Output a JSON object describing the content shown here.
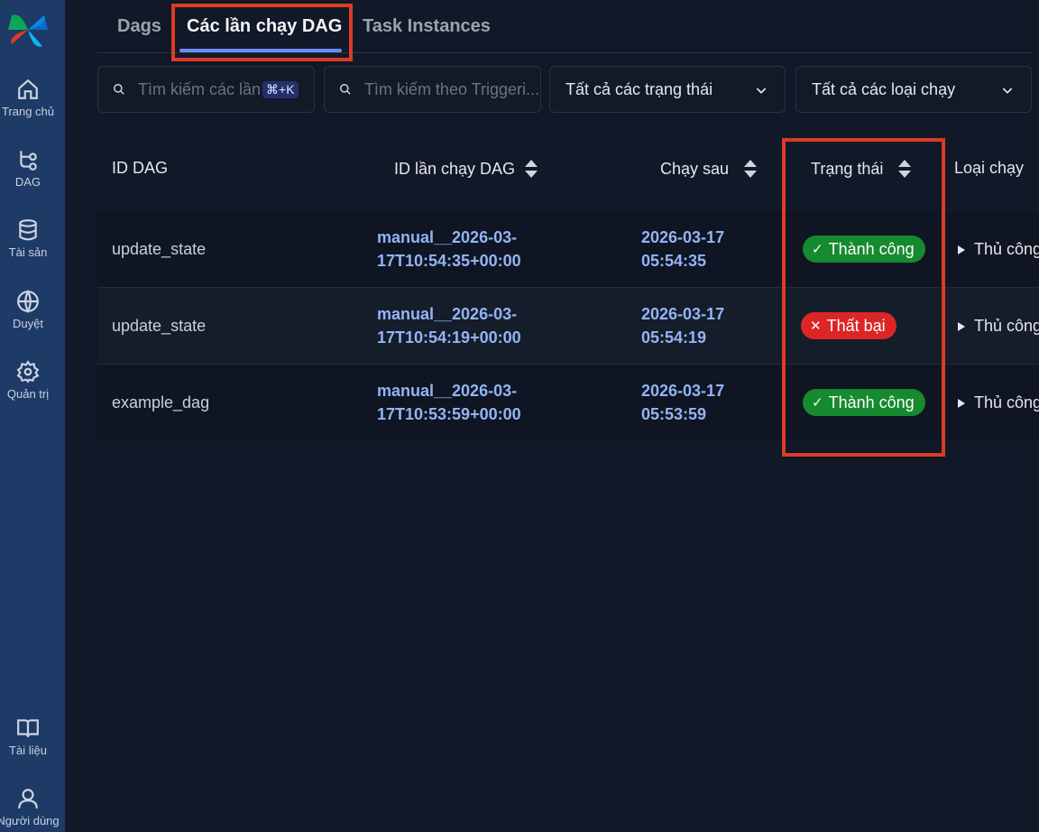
{
  "sidebar": {
    "items": [
      {
        "label": "Trang chủ",
        "icon": "home-icon"
      },
      {
        "label": "DAG",
        "icon": "dag-icon"
      },
      {
        "label": "Tài sản",
        "icon": "database-icon"
      },
      {
        "label": "Duyệt",
        "icon": "globe-icon"
      },
      {
        "label": "Quản trị",
        "icon": "gear-icon"
      }
    ],
    "bottom_items": [
      {
        "label": "Tài liệu",
        "icon": "book-icon"
      },
      {
        "label": "Người dùng",
        "icon": "user-icon"
      }
    ]
  },
  "tabs": [
    {
      "label": "Dags"
    },
    {
      "label": "Các lần chạy DAG"
    },
    {
      "label": "Task Instances"
    }
  ],
  "filters": {
    "search_runs_placeholder": "Tìm kiếm các lần",
    "search_runs_shortcut": "⌘+K",
    "search_trigger_placeholder": "Tìm kiếm theo Triggeri...",
    "state_select": "Tất cả các trạng thái",
    "run_type_select": "Tất cả các loại chạy"
  },
  "table": {
    "columns": [
      "ID DAG",
      "ID lần chạy DAG",
      "Chạy sau",
      "Trạng thái",
      "Loại chạy"
    ],
    "rows": [
      {
        "dag_id": "update_state",
        "run_id_1": "manual__2026-03-",
        "run_id_2": "17T10:54:35+00:00",
        "after_1": "2026-03-17",
        "after_2": "05:54:35",
        "state": "Thành công",
        "run_type": "Thủ công"
      },
      {
        "dag_id": "update_state",
        "run_id_1": "manual__2026-03-",
        "run_id_2": "17T10:54:19+00:00",
        "after_1": "2026-03-17",
        "after_2": "05:54:19",
        "state": "Thất bại",
        "run_type": "Thủ công"
      },
      {
        "dag_id": "example_dag",
        "run_id_1": "manual__2026-03-",
        "run_id_2": "17T10:53:59+00:00",
        "after_1": "2026-03-17",
        "after_2": "05:53:59",
        "state": "Thành công",
        "run_type": "Thủ công"
      }
    ]
  },
  "colors": {
    "success": "#168a2e",
    "failed": "#dc2626",
    "highlight": "#dc3b26",
    "sidebar": "#1e3a66"
  }
}
